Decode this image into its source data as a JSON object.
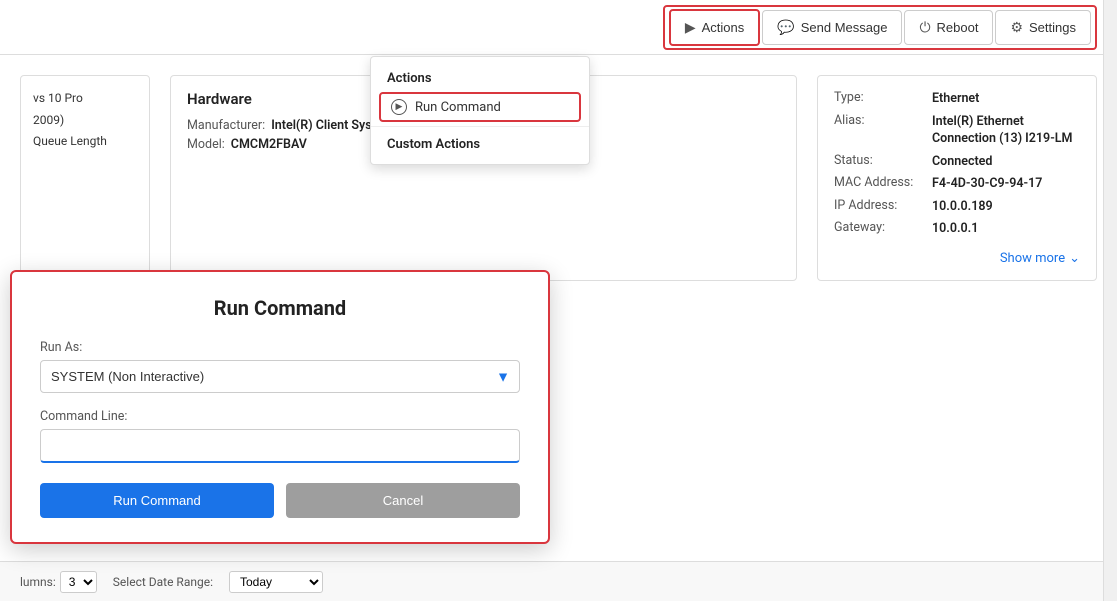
{
  "toolbar": {
    "actions_label": "Actions",
    "send_message_label": "Send Message",
    "reboot_label": "Reboot",
    "settings_label": "Settings"
  },
  "actions_dropdown": {
    "section_title": "Actions",
    "run_command_label": "Run Command",
    "custom_actions_title": "Custom Actions"
  },
  "left_card": {
    "line1": "vs 10 Pro",
    "line2": "2009)",
    "line3": "Queue Length"
  },
  "hardware_card": {
    "title": "Hardware",
    "manufacturer_label": "Manufacturer:",
    "manufacturer_value": "Intel(R) Client Systems",
    "model_label": "Model:",
    "model_value": "CMCM2FBAV"
  },
  "network_card": {
    "type_label": "Type:",
    "type_value": "Ethernet",
    "alias_label": "Alias:",
    "alias_value": "Intel(R) Ethernet Connection (13) I219-LM",
    "status_label": "Status:",
    "status_value": "Connected",
    "mac_label": "MAC Address:",
    "mac_value": "F4-4D-30-C9-94-17",
    "ip_label": "IP Address:",
    "ip_value": "10.0.0.189",
    "gateway_label": "Gateway:",
    "gateway_value": "10.0.0.1",
    "show_more_label": "Show more"
  },
  "modal": {
    "title": "Run Command",
    "run_as_label": "Run As:",
    "run_as_value": "SYSTEM (Non Interactive)",
    "command_line_label": "Command Line:",
    "command_line_placeholder": "",
    "run_button_label": "Run Command",
    "cancel_button_label": "Cancel"
  },
  "bottom_bar": {
    "columns_label": "lumns:",
    "columns_value": "3",
    "date_range_label": "Select Date Range:",
    "date_range_value": "Today"
  }
}
